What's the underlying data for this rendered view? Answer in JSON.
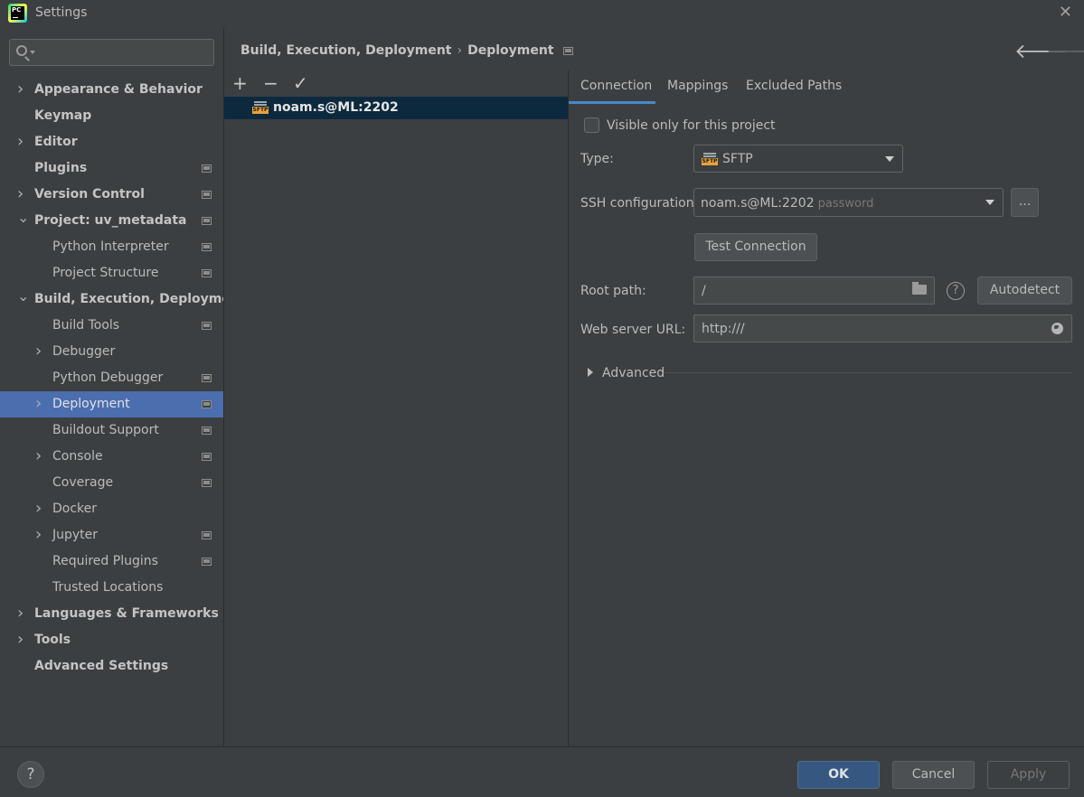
{
  "window": {
    "title": "Settings",
    "app_icon_text": "PC"
  },
  "search": {
    "placeholder": "",
    "value": ""
  },
  "sidebar": {
    "items": [
      {
        "label": "Appearance & Behavior",
        "bold": true,
        "chevron": "right",
        "has_proj_icon": false
      },
      {
        "label": "Keymap",
        "bold": true,
        "chevron": "none",
        "has_proj_icon": false
      },
      {
        "label": "Editor",
        "bold": true,
        "chevron": "right",
        "has_proj_icon": false
      },
      {
        "label": "Plugins",
        "bold": true,
        "chevron": "none",
        "has_proj_icon": true
      },
      {
        "label": "Version Control",
        "bold": true,
        "chevron": "right",
        "has_proj_icon": true
      },
      {
        "label": "Project: uv_metadata",
        "bold": true,
        "chevron": "down",
        "has_proj_icon": true
      },
      {
        "label": "Python Interpreter",
        "bold": false,
        "chevron": "none",
        "has_proj_icon": true
      },
      {
        "label": "Project Structure",
        "bold": false,
        "chevron": "none",
        "has_proj_icon": true
      },
      {
        "label": "Build, Execution, Deployment",
        "bold": true,
        "chevron": "down",
        "has_proj_icon": false
      },
      {
        "label": "Build Tools",
        "bold": false,
        "chevron": "none",
        "has_proj_icon": true
      },
      {
        "label": "Debugger",
        "bold": false,
        "chevron": "right",
        "has_proj_icon": false
      },
      {
        "label": "Python Debugger",
        "bold": false,
        "chevron": "none",
        "has_proj_icon": true
      },
      {
        "label": "Deployment",
        "bold": false,
        "chevron": "right",
        "has_proj_icon": true,
        "selected": true
      },
      {
        "label": "Buildout Support",
        "bold": false,
        "chevron": "none",
        "has_proj_icon": true
      },
      {
        "label": "Console",
        "bold": false,
        "chevron": "right",
        "has_proj_icon": true
      },
      {
        "label": "Coverage",
        "bold": false,
        "chevron": "none",
        "has_proj_icon": true
      },
      {
        "label": "Docker",
        "bold": false,
        "chevron": "right",
        "has_proj_icon": false
      },
      {
        "label": "Jupyter",
        "bold": false,
        "chevron": "right",
        "has_proj_icon": true
      },
      {
        "label": "Required Plugins",
        "bold": false,
        "chevron": "none",
        "has_proj_icon": true
      },
      {
        "label": "Trusted Locations",
        "bold": false,
        "chevron": "none",
        "has_proj_icon": false
      },
      {
        "label": "Languages & Frameworks",
        "bold": true,
        "chevron": "right",
        "has_proj_icon": false
      },
      {
        "label": "Tools",
        "bold": true,
        "chevron": "right",
        "has_proj_icon": false
      },
      {
        "label": "Advanced Settings",
        "bold": true,
        "chevron": "none",
        "has_proj_icon": false
      }
    ]
  },
  "breadcrumb": {
    "parent": "Build, Execution, Deployment",
    "separator": "›",
    "current": "Deployment"
  },
  "server_list": {
    "toolbar": {
      "add": "+",
      "remove": "−",
      "default": "✓"
    },
    "servers": [
      {
        "name": "noam.s@ML:2202",
        "icon_tag": "SFTP"
      }
    ]
  },
  "tabs": [
    "Connection",
    "Mappings",
    "Excluded Paths"
  ],
  "connection": {
    "visible_only_label": "Visible only for this project",
    "type_label": "Type:",
    "type_value": "SFTP",
    "ssh_label": "SSH configuration:",
    "ssh_value": "noam.s@ML:2202",
    "ssh_hint": "password",
    "ssh_more": "...",
    "test_connection": "Test Connection",
    "root_path_label": "Root path:",
    "root_path_value": "/",
    "help_glyph": "?",
    "autodetect": "Autodetect",
    "web_url_label": "Web server URL:",
    "web_url_value": "http:///",
    "advanced_label": "Advanced"
  },
  "footer": {
    "help": "?",
    "ok": "OK",
    "cancel": "Cancel",
    "apply": "Apply"
  },
  "colors": {
    "accent": "#4b6eaf",
    "selected_row": "#0d293e",
    "tab_underline": "#4a88c7",
    "ok_button": "#365880",
    "sftp_tag": "#e8a33c"
  }
}
